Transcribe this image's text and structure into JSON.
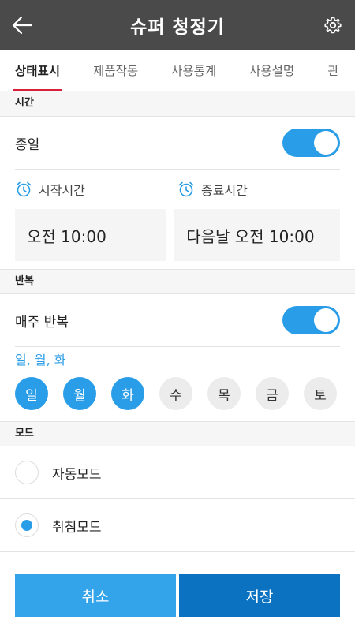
{
  "header": {
    "title": "슈퍼 청정기",
    "back_icon": "arrow-left-icon",
    "settings_icon": "gear-icon"
  },
  "tabs": [
    {
      "label": "상태표시",
      "active": true
    },
    {
      "label": "제품작동",
      "active": false
    },
    {
      "label": "사용통계",
      "active": false
    },
    {
      "label": "사용설명",
      "active": false
    },
    {
      "label": "관",
      "active": false
    }
  ],
  "time_section": {
    "title": "시간",
    "all_day_label": "종일",
    "all_day_on": true,
    "start_label": "시작시간",
    "end_label": "종료시간",
    "start_value": "오전 10:00",
    "end_value": "다음날 오전 10:00"
  },
  "repeat_section": {
    "title": "반복",
    "weekly_label": "매주 반복",
    "weekly_on": true,
    "selected_days_text": "일, 월, 화",
    "days": [
      {
        "label": "일",
        "selected": true
      },
      {
        "label": "월",
        "selected": true
      },
      {
        "label": "화",
        "selected": true
      },
      {
        "label": "수",
        "selected": false
      },
      {
        "label": "목",
        "selected": false
      },
      {
        "label": "금",
        "selected": false
      },
      {
        "label": "토",
        "selected": false
      }
    ]
  },
  "mode_section": {
    "title": "모드",
    "options": [
      {
        "label": "자동모드",
        "selected": false
      },
      {
        "label": "취침모드",
        "selected": true
      }
    ]
  },
  "footer": {
    "cancel_label": "취소",
    "save_label": "저장"
  },
  "colors": {
    "header_bg": "#4a4a4a",
    "accent": "#2a9de8",
    "tab_underline": "#d81f3c",
    "save_btn": "#0a72c1",
    "cancel_btn": "#33a3ea"
  }
}
